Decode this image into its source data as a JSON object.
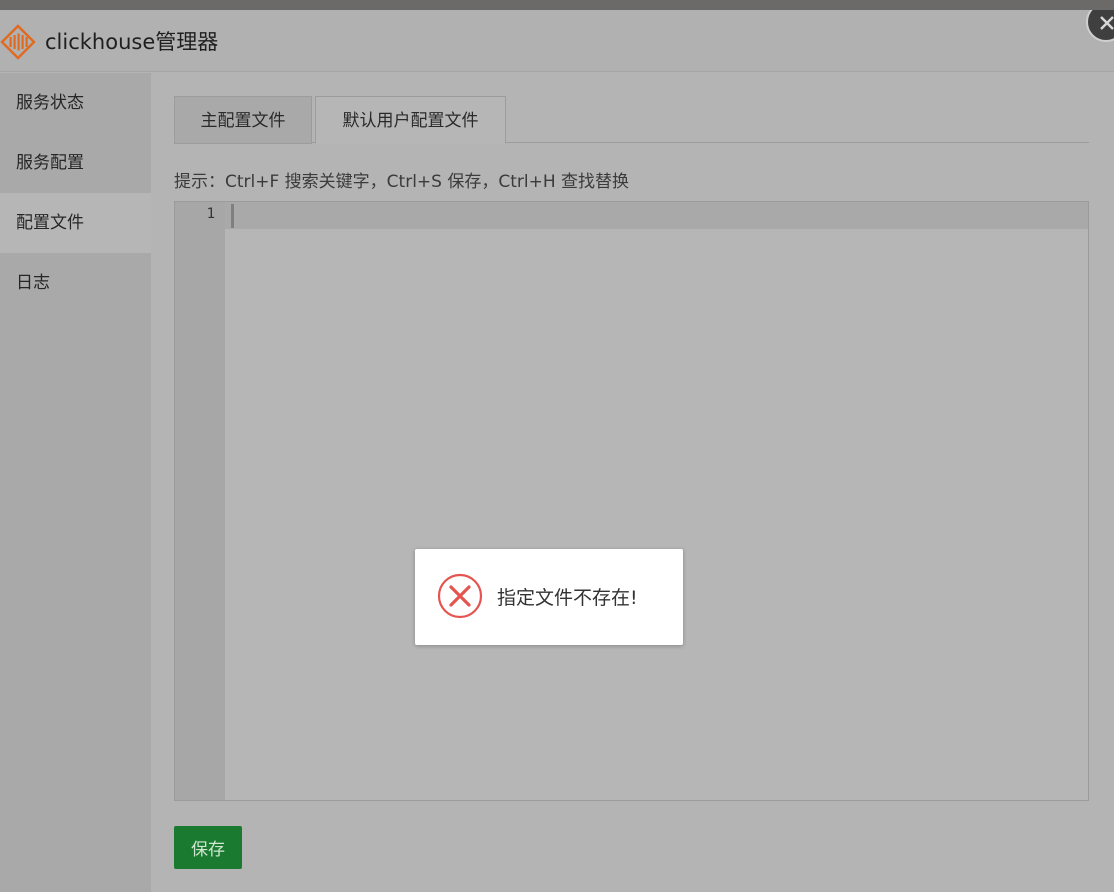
{
  "app": {
    "title": "clickhouse管理器",
    "brand_color": "#e06a1f"
  },
  "sidebar": {
    "items": [
      {
        "label": "服务状态",
        "active": false
      },
      {
        "label": "服务配置",
        "active": false
      },
      {
        "label": "配置文件",
        "active": true
      },
      {
        "label": "日志",
        "active": false
      }
    ]
  },
  "tabs": [
    {
      "label": "主配置文件",
      "active": false
    },
    {
      "label": "默认用户配置文件",
      "active": true
    }
  ],
  "hint": "提示：Ctrl+F 搜索关键字，Ctrl+S 保存，Ctrl+H 查找替换",
  "editor": {
    "line_numbers": [
      "1"
    ],
    "content": ""
  },
  "save_button": {
    "label": "保存",
    "color": "#1a7a2f"
  },
  "toast": {
    "message": "指定文件不存在!",
    "icon": "error-circle-x-icon",
    "icon_color": "#e5554f"
  }
}
